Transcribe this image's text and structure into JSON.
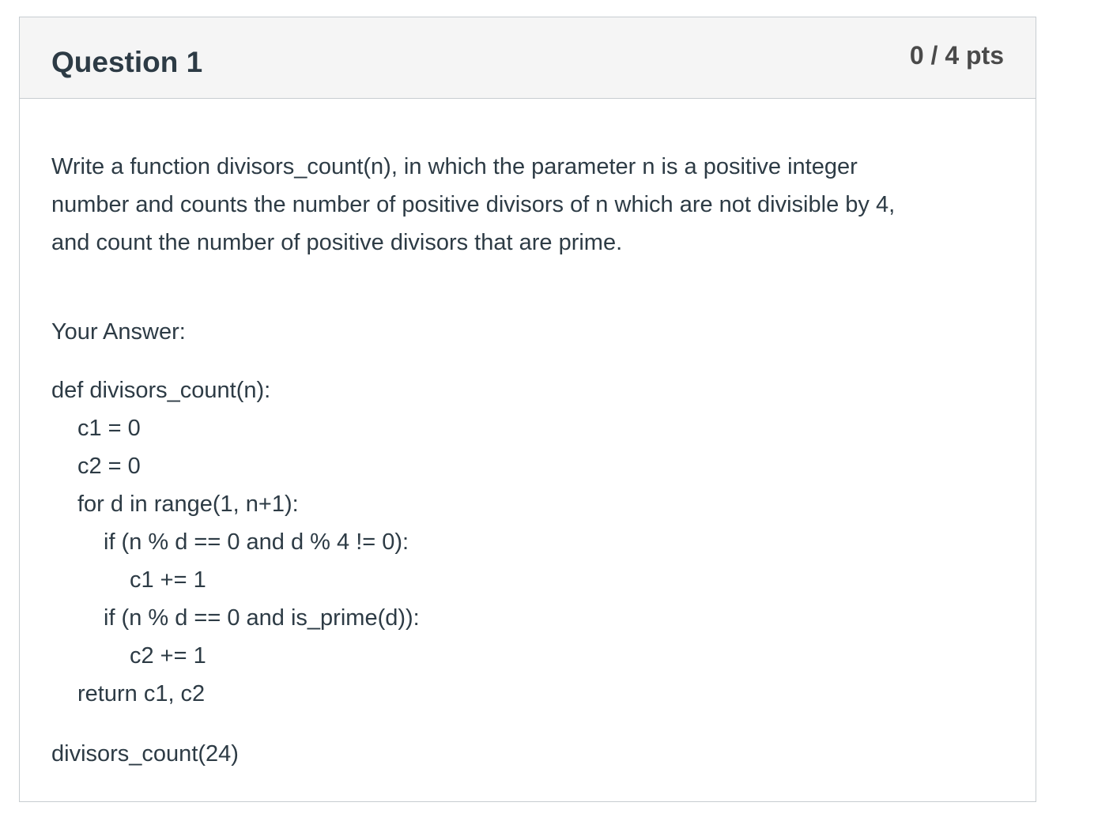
{
  "question": {
    "title": "Question 1",
    "points": "0 / 4 pts",
    "text": "Write a function divisors_count(n), in which the parameter n is a positive integer\nnumber and counts the number of positive divisors of n which are not divisible by 4,\nand count the number of positive divisors that are prime."
  },
  "answer": {
    "label": "Your Answer:",
    "code_lines": [
      "def divisors_count(n):",
      "c1 = 0",
      "c2 = 0",
      "for d in range(1, n+1):",
      "if (n % d == 0 and d % 4 != 0):",
      "c1 += 1",
      "if (n % d == 0 and is_prime(d)):",
      "c2 += 1",
      "return c1, c2"
    ],
    "call": "divisors_count(24)"
  }
}
